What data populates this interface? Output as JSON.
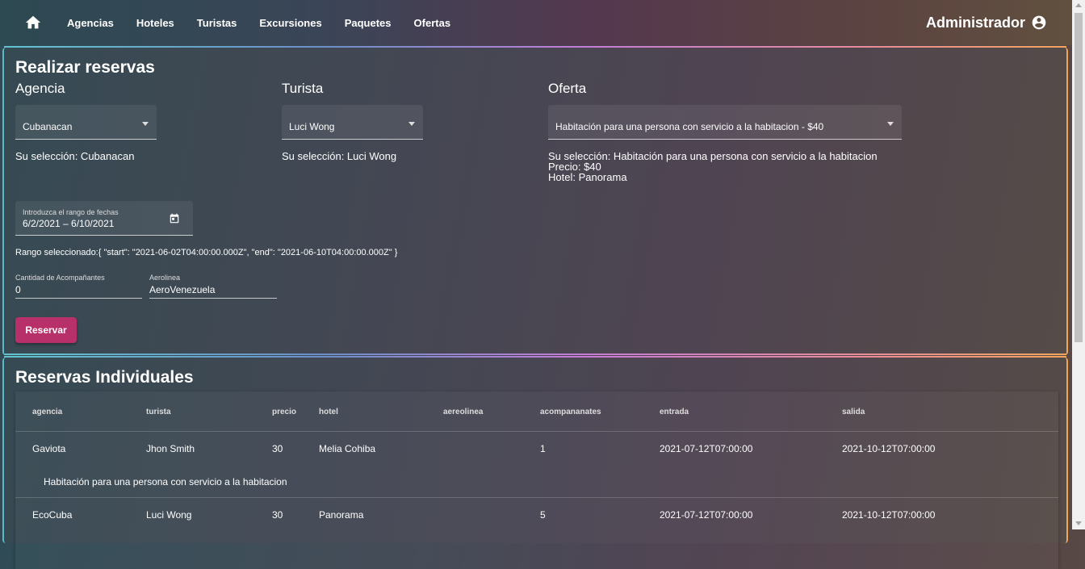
{
  "navbar": {
    "home_icon": "home-icon",
    "links": [
      "Agencias",
      "Hoteles",
      "Turistas",
      "Excursiones",
      "Paquetes",
      "Ofertas"
    ],
    "user_name": "Administrador",
    "user_icon": "account-circle-icon"
  },
  "reserva": {
    "title": "Realizar reservas",
    "agencia": {
      "label": "Agencia",
      "value": "Cubanacan",
      "seleccion": "Su selección: Cubanacan"
    },
    "turista": {
      "label": "Turista",
      "value": "Luci Wong",
      "seleccion": "Su selección: Luci Wong"
    },
    "oferta": {
      "label": "Oferta",
      "value": "Habitación para una persona con servicio a la habitacion - $40",
      "seleccion": "Su selección: Habitación para una persona con servicio a la habitacion",
      "precio": "Precio: $40",
      "hotel": "Hotel: Panorama"
    },
    "fechas": {
      "label": "Introduzca el rango de fechas",
      "value": "6/2/2021 – 6/10/2021",
      "rango_text": "Rango seleccionado:{ \"start\": \"2021-06-02T04:00:00.000Z\", \"end\": \"2021-06-10T04:00:00.000Z\" }"
    },
    "acompanantes": {
      "label": "Cantidad de Acompañantes",
      "value": "0"
    },
    "aerolinea": {
      "label": "Aerolinea",
      "value": "AeroVenezuela"
    },
    "button_label": "Reservar"
  },
  "individuales": {
    "title": "Reservas Individuales",
    "columns": [
      "agencia",
      "turista",
      "precio",
      "hotel",
      "aereolinea",
      "acompananates",
      "entrada",
      "salida"
    ],
    "rows": [
      {
        "agencia": "Gaviota",
        "turista": "Jhon Smith",
        "precio": "30",
        "hotel": "Melia Cohiba",
        "aereolinea": "",
        "acompanantes": "1",
        "entrada": "2021-07-12T07:00:00",
        "salida": "2021-10-12T07:00:00",
        "detalle": "Habitación para una persona con servicio a la habitacion"
      },
      {
        "agencia": "EcoCuba",
        "turista": "Luci Wong",
        "precio": "30",
        "hotel": "Panorama",
        "aereolinea": "",
        "acompanantes": "5",
        "entrada": "2021-07-12T07:00:00",
        "salida": "2021-10-12T07:00:00"
      }
    ]
  },
  "colors": {
    "accent": "#b8306a"
  }
}
